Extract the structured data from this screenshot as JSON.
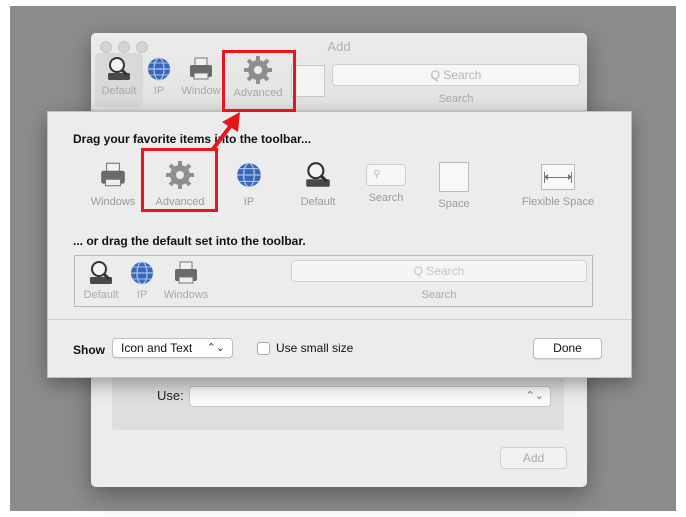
{
  "window": {
    "title": "Add",
    "toolbar": [
      {
        "label": "Default",
        "icon": "magnifier-device-icon"
      },
      {
        "label": "IP",
        "icon": "globe-icon"
      },
      {
        "label": "Window",
        "icon": "printer-icon"
      },
      {
        "label": "Advanced",
        "icon": "gear-icon"
      }
    ],
    "search_placeholder": "Q Search",
    "search_label": "Search",
    "use_label": "Use:",
    "add_button": "Add"
  },
  "customize_sheet": {
    "heading_items": "Drag your favorite items into the toolbar...",
    "palette": [
      {
        "label": "Windows",
        "icon": "printer-icon"
      },
      {
        "label": "Advanced",
        "icon": "gear-icon"
      },
      {
        "label": "IP",
        "icon": "globe-icon"
      },
      {
        "label": "Default",
        "icon": "magnifier-device-icon"
      },
      {
        "label": "Search",
        "icon": "search-field-icon"
      },
      {
        "label": "Space",
        "icon": "space-icon"
      },
      {
        "label": "Flexible Space",
        "icon": "flexible-space-icon"
      }
    ],
    "heading_default": "... or drag the default set into the toolbar.",
    "default_set": [
      {
        "label": "Default",
        "icon": "magnifier-device-icon"
      },
      {
        "label": "IP",
        "icon": "globe-icon"
      },
      {
        "label": "Windows",
        "icon": "printer-icon"
      }
    ],
    "default_search_placeholder": "Q Search",
    "default_search_label": "Search",
    "show_label": "Show",
    "show_value": "Icon and Text",
    "small_size_label": "Use small size",
    "small_size_checked": false,
    "done_button": "Done"
  },
  "annotation": {
    "color": "#e8161c"
  }
}
